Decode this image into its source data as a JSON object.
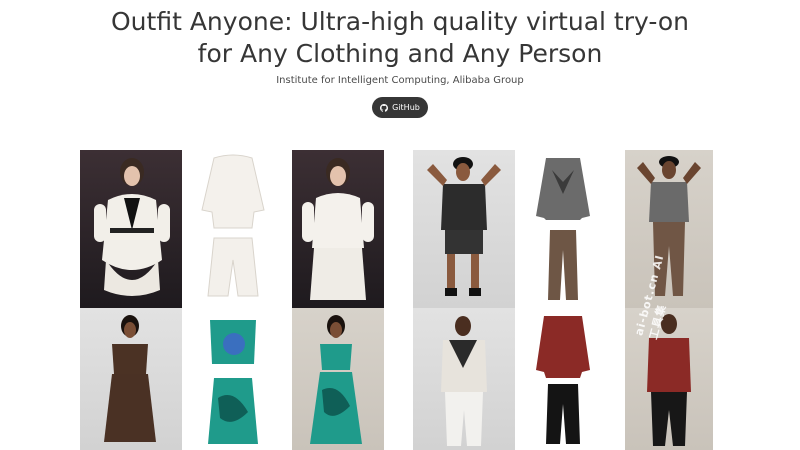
{
  "header": {
    "title": "Outfit Anyone: Ultra-high quality virtual try-on for Any Clothing and Any Person",
    "affiliation": "Institute for Intelligent Computing, Alibaba Group",
    "github_label": "GitHub"
  },
  "gallery": {
    "tiles": [
      {
        "kind": "model-photo",
        "outfit": "white blazer dress with black lapel"
      },
      {
        "kind": "garment",
        "outfit": "white blouse and white shorts"
      },
      {
        "kind": "try-on-result",
        "outfit": "white blouse and white shorts"
      },
      {
        "kind": "model-photo",
        "outfit": "black shirt and shorts"
      },
      {
        "kind": "garment",
        "outfit": "grey argyle cardigan and brown trousers"
      },
      {
        "kind": "try-on-result",
        "outfit": "grey argyle cardigan and brown trousers"
      },
      {
        "kind": "model-photo",
        "outfit": "brown polka dot dress"
      },
      {
        "kind": "garment",
        "outfit": "teal crop top and teal skirt"
      },
      {
        "kind": "try-on-result",
        "outfit": "teal crop top and teal skirt"
      },
      {
        "kind": "model-photo",
        "outfit": "plaid jacket and white trousers"
      },
      {
        "kind": "garment",
        "outfit": "red hoodie and black joggers"
      },
      {
        "kind": "try-on-result",
        "outfit": "red hoodie and black joggers"
      }
    ]
  },
  "watermark_text": "ai-bot.cn AI工具集",
  "colors": {
    "title": "#363636",
    "button_bg": "#363636",
    "button_text": "#ffffff"
  }
}
